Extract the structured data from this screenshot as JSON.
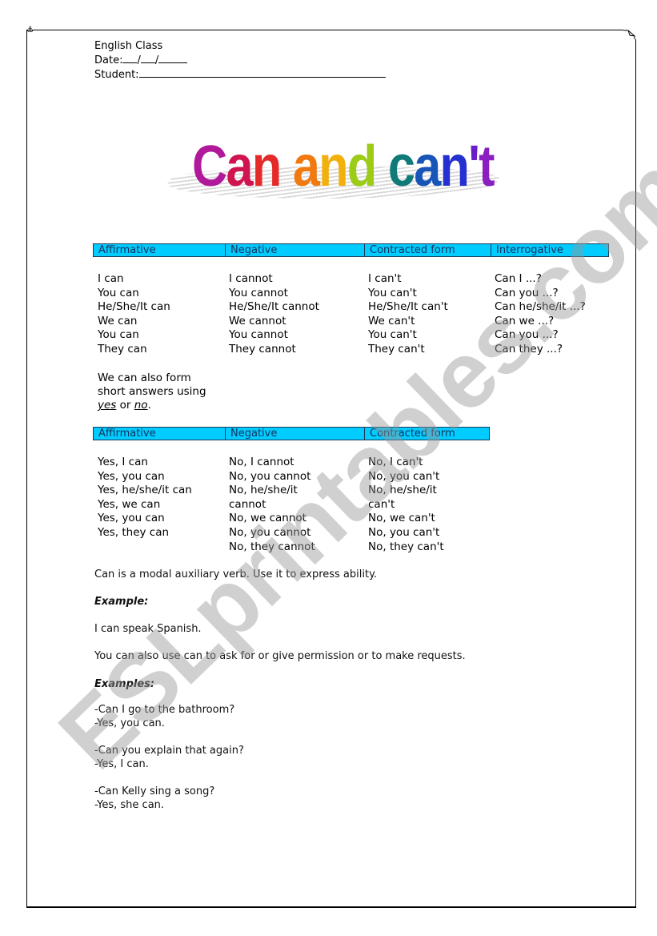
{
  "header": {
    "class_label": "English Class",
    "date_label": "Date:",
    "student_label": "Student:"
  },
  "title": {
    "text": "Can and can't",
    "letters": [
      {
        "ch": "C",
        "color": "#b0199a"
      },
      {
        "ch": "a",
        "color": "#d0144f"
      },
      {
        "ch": "n",
        "color": "#e52a2a"
      },
      {
        "ch": " ",
        "color": "#ffffff"
      },
      {
        "ch": "a",
        "color": "#f07a10"
      },
      {
        "ch": "n",
        "color": "#f2b00c"
      },
      {
        "ch": "d",
        "color": "#9ccc18"
      },
      {
        "ch": " ",
        "color": "#ffffff"
      },
      {
        "ch": "c",
        "color": "#0f7a78"
      },
      {
        "ch": "a",
        "color": "#1755b8"
      },
      {
        "ch": "n",
        "color": "#2430d0"
      },
      {
        "ch": "'",
        "color": "#6a1ec8"
      },
      {
        "ch": "t",
        "color": "#8a1ec0"
      }
    ]
  },
  "table1": {
    "headers": [
      "Affirmative",
      "Negative",
      "Contracted form",
      "Interrogative"
    ],
    "columns": [
      [
        "I can",
        "You can",
        "He/She/It can",
        "We can",
        "You can",
        "They can"
      ],
      [
        "I cannot",
        "You cannot",
        "He/She/It cannot",
        "We cannot",
        "You cannot",
        "They cannot"
      ],
      [
        "I can't",
        "You can't",
        "He/She/It can't",
        "We can't",
        "You can't",
        "They can't"
      ],
      [
        "Can I ...?",
        "Can you ...?",
        "Can he/she/it ...?",
        "Can we ...?",
        "Can you ...?",
        "Can they ...?"
      ]
    ]
  },
  "note": {
    "line1": "We can also form",
    "line2": "short answers using",
    "yes": "yes",
    "or": " or ",
    "no": "no",
    "end": "."
  },
  "table2": {
    "headers": [
      "Affirmative",
      "Negative",
      "Contracted form"
    ],
    "columns": [
      [
        "Yes, I can",
        "Yes, you can",
        "",
        "Yes, he/she/it can",
        "Yes, we can",
        "Yes, you can",
        "Yes, they can"
      ],
      [
        "No, I cannot",
        "No, you cannot",
        "No, he/she/it",
        "cannot",
        "No, we cannot",
        "No, you cannot",
        "No, they cannot"
      ],
      [
        "No, I can't",
        "No, you can't",
        "No, he/she/it",
        "can't",
        "No, we can't",
        "No, you can't",
        "No, they can't"
      ]
    ]
  },
  "body": {
    "p1": "Can is a modal auxiliary verb. Use it to express ability.",
    "example_label": "Example:",
    "example": "I can speak Spanish.",
    "p2": "You can also use can to ask for or give permission or to make requests.",
    "examples_label": "Examples:",
    "dialogues": [
      [
        "-Can I go to the bathroom?",
        "-Yes, you can."
      ],
      [
        "-Can you explain that again?",
        "-Yes, I can."
      ],
      [
        "-Can Kelly sing a song?",
        "-Yes, she can."
      ]
    ]
  },
  "watermark": "ESLprintables.com",
  "colors": {
    "header_bg": "#00ccff",
    "header_text": "#12305a"
  }
}
